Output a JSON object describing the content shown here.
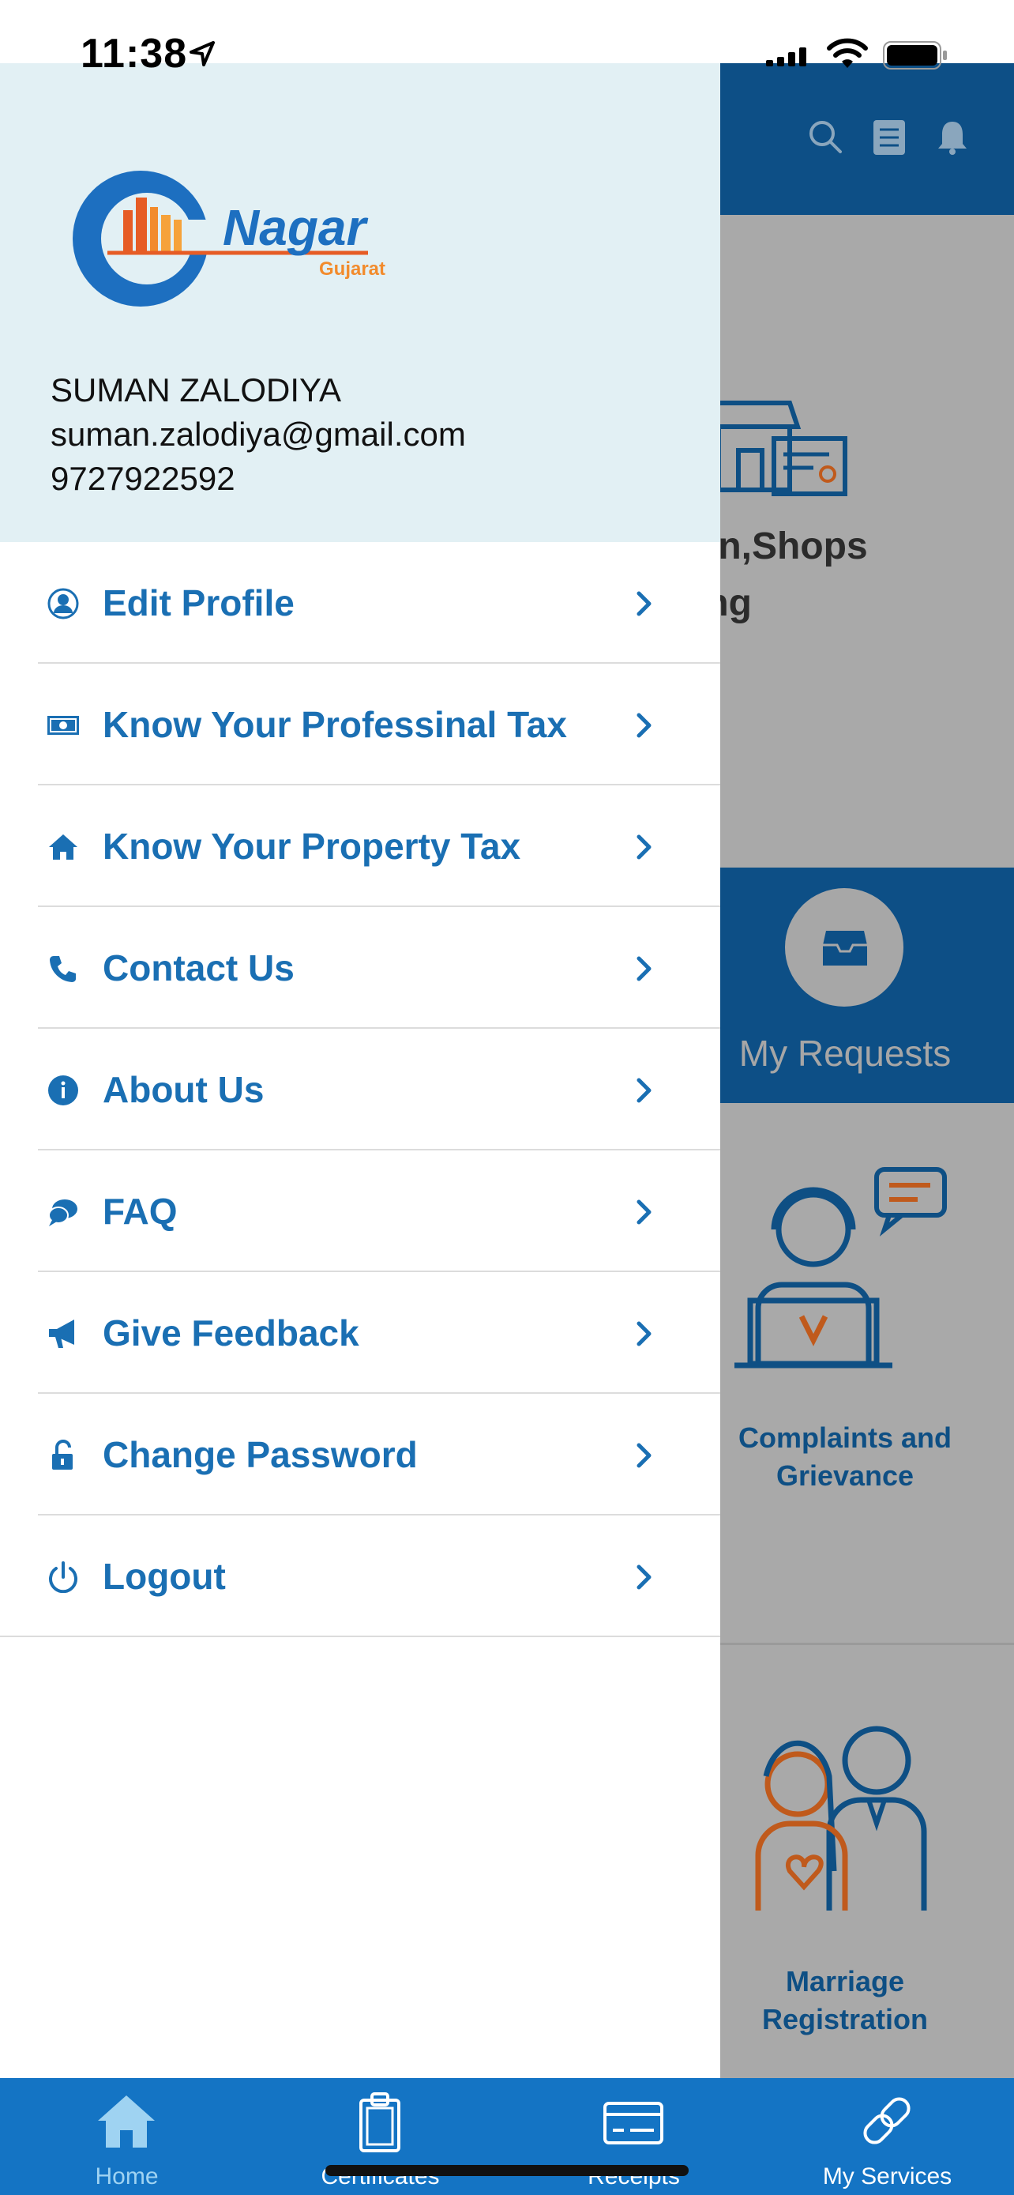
{
  "status_bar": {
    "time": "11:38",
    "icons": [
      "location-arrow-icon",
      "signal-icon",
      "wifi-icon",
      "battery-icon"
    ]
  },
  "drawer": {
    "logo": {
      "name": "Nagar",
      "subtitle": "Gujarat"
    },
    "user": {
      "name": "SUMAN ZALODIYA",
      "email": "suman.zalodiya@gmail.com",
      "phone": "9727922592"
    },
    "menu": [
      {
        "label": "Edit Profile",
        "icon": "user-circle-icon"
      },
      {
        "label": "Know Your Professinal Tax",
        "icon": "money-icon"
      },
      {
        "label": "Know Your Property Tax",
        "icon": "home-icon"
      },
      {
        "label": "Contact Us",
        "icon": "phone-icon"
      },
      {
        "label": "About Us",
        "icon": "info-icon"
      },
      {
        "label": "FAQ",
        "icon": "chat-bubbles-icon"
      },
      {
        "label": "Give Feedback",
        "icon": "megaphone-icon"
      },
      {
        "label": "Change Password",
        "icon": "unlock-icon"
      },
      {
        "label": "Logout",
        "icon": "power-icon"
      }
    ]
  },
  "background": {
    "shops_label_line1": "on,Shops",
    "shops_label_line2": "ing",
    "my_requests_label": "My Requests",
    "complaints_label": "Complaints and Grievance",
    "marriage_label": "Marriage Registration"
  },
  "tab_bar": {
    "tabs": [
      {
        "label": "Home",
        "icon": "home-icon",
        "active": true
      },
      {
        "label": "Certificates",
        "icon": "clipboard-icon",
        "active": false
      },
      {
        "label": "Receipts",
        "icon": "card-icon",
        "active": false
      },
      {
        "label": "My Services",
        "icon": "link-icon",
        "active": false
      }
    ]
  },
  "colors": {
    "accent": "#1a6fb3",
    "header_blue": "#0d4f86",
    "tab_bar": "#1474c4",
    "active_tab": "#9fd3f2",
    "drawer_header": "#e2f0f4"
  }
}
